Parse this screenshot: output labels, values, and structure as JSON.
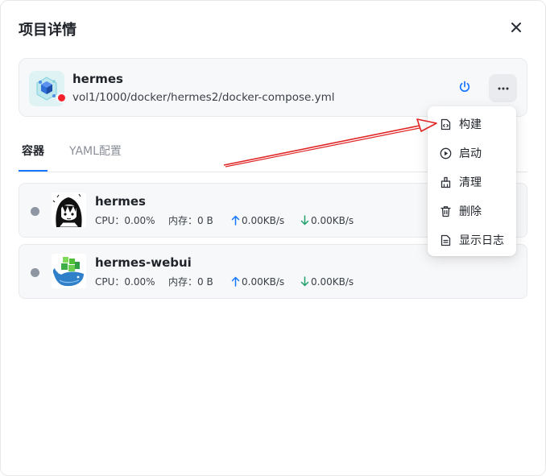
{
  "dialog": {
    "title": "项目详情"
  },
  "project": {
    "name": "hermes",
    "path": "vol1/1000/docker/hermes2/docker-compose.yml",
    "status_color": "#f5222d"
  },
  "tabs": [
    {
      "label": "容器",
      "active": true
    },
    {
      "label": "YAML配置",
      "active": false
    }
  ],
  "containers": [
    {
      "name": "hermes",
      "cpu": "CPU：0.00%",
      "memory": "内存：0 B",
      "upload": "0.00KB/s",
      "download": "0.00KB/s",
      "icon": "anime-girl-avatar-icon"
    },
    {
      "name": "hermes-webui",
      "cpu": "CPU：0.00%",
      "memory": "内存：0 B",
      "upload": "0.00KB/s",
      "download": "0.00KB/s",
      "icon": "whale-logo-icon"
    }
  ],
  "menu": {
    "items": [
      {
        "label": "构建",
        "icon": "build-icon"
      },
      {
        "label": "启动",
        "icon": "play-icon"
      },
      {
        "label": "清理",
        "icon": "broom-icon"
      },
      {
        "label": "删除",
        "icon": "trash-icon"
      },
      {
        "label": "显示日志",
        "icon": "log-icon"
      }
    ]
  },
  "colors": {
    "accent": "#1677ff",
    "upload_arrow": "#1677ff",
    "download_arrow": "#22a06b",
    "annotation_arrow": "#e02424"
  }
}
